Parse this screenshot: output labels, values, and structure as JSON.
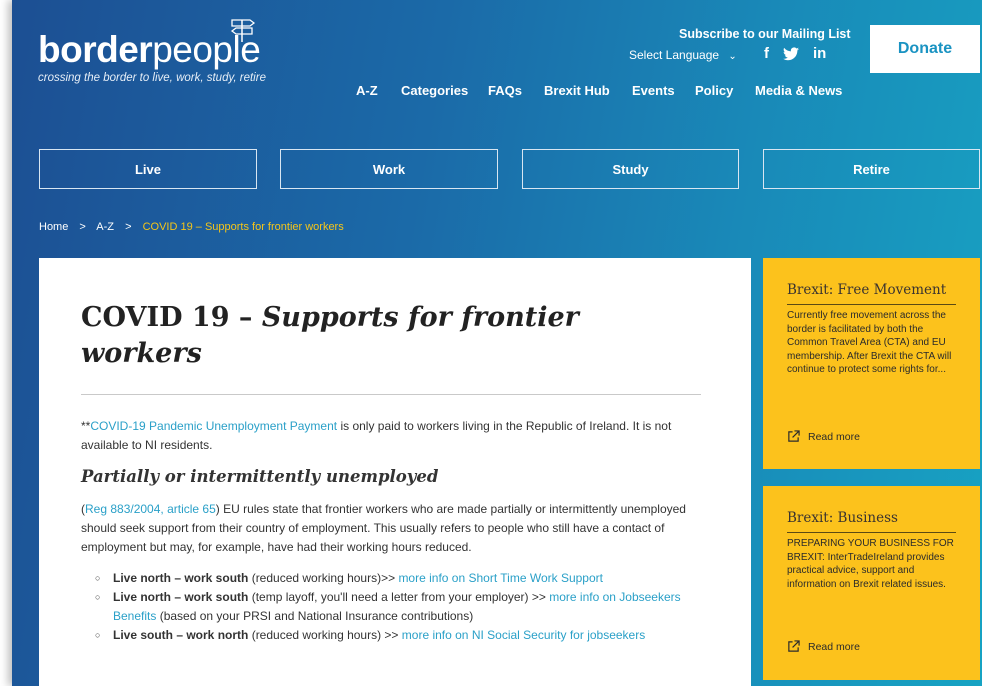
{
  "logo": {
    "bold": "border",
    "light": "people",
    "tagline": "crossing the border to live, work, study, retire"
  },
  "header": {
    "subscribe": "Subscribe to our Mailing List",
    "language": "Select Language",
    "social": [
      "f",
      "in"
    ],
    "donate": "Donate"
  },
  "nav": [
    "A-Z",
    "Categories",
    "FAQs",
    "Brexit Hub",
    "Events",
    "Policy",
    "Media & News"
  ],
  "sections": [
    "Live",
    "Work",
    "Study",
    "Retire"
  ],
  "breadcrumb": {
    "home": "Home",
    "az": "A-Z",
    "current": "COVID 19 – Supports for frontier workers",
    "sep": ">"
  },
  "article": {
    "title_upright": "COVID 19 – ",
    "title_italic": "Supports for frontier workers",
    "intro_prefix": "**",
    "intro_link": "COVID-19 Pandemic Unemployment Payment",
    "intro_text": " is only paid to workers living in the Republic of Ireland.  It is not available to NI residents.",
    "subhead": "Partially or intermittently unemployed",
    "para2_open": "(",
    "para2_link": "Reg 883/2004, article 65",
    "para2_text": ") EU rules state that frontier workers who are made partially or intermittently unemployed should seek support from their country of employment. This usually refers to people who still have a contact of employment but may, for example, have had their working hours reduced.",
    "items": [
      {
        "bold": "Live north – work south",
        "text": " (reduced working hours)>> ",
        "link": "more info on Short Time Work Support",
        "after": ""
      },
      {
        "bold": "Live north – work south",
        "text": " (temp layoff, you'll need a letter from your employer) >> ",
        "link": "more info on Jobseekers Benefits",
        "after": " (based on your PRSI and National Insurance contributions)"
      },
      {
        "bold": "Live south – work north",
        "text": " (reduced working hours) >> ",
        "link": "more info on NI Social Security for jobseekers",
        "after": ""
      }
    ]
  },
  "sidebar": {
    "cards": [
      {
        "title": "Brexit: Free Movement",
        "body": "Currently free movement across the border is facilitated by both the Common Travel Area (CTA) and EU membership. After Brexit the CTA will continue to protect some rights for...",
        "more": "Read more"
      },
      {
        "title": "Brexit: Business",
        "body": "PREPARING YOUR BUSINESS FOR BREXIT: InterTradeIreland provides practical advice, support and information on Brexit related issues.",
        "more": "Read more"
      }
    ]
  },
  "colors": {
    "accent": "#2aa0c8",
    "card": "#fcc21c",
    "breadcrumb_current": "#f5c518"
  }
}
